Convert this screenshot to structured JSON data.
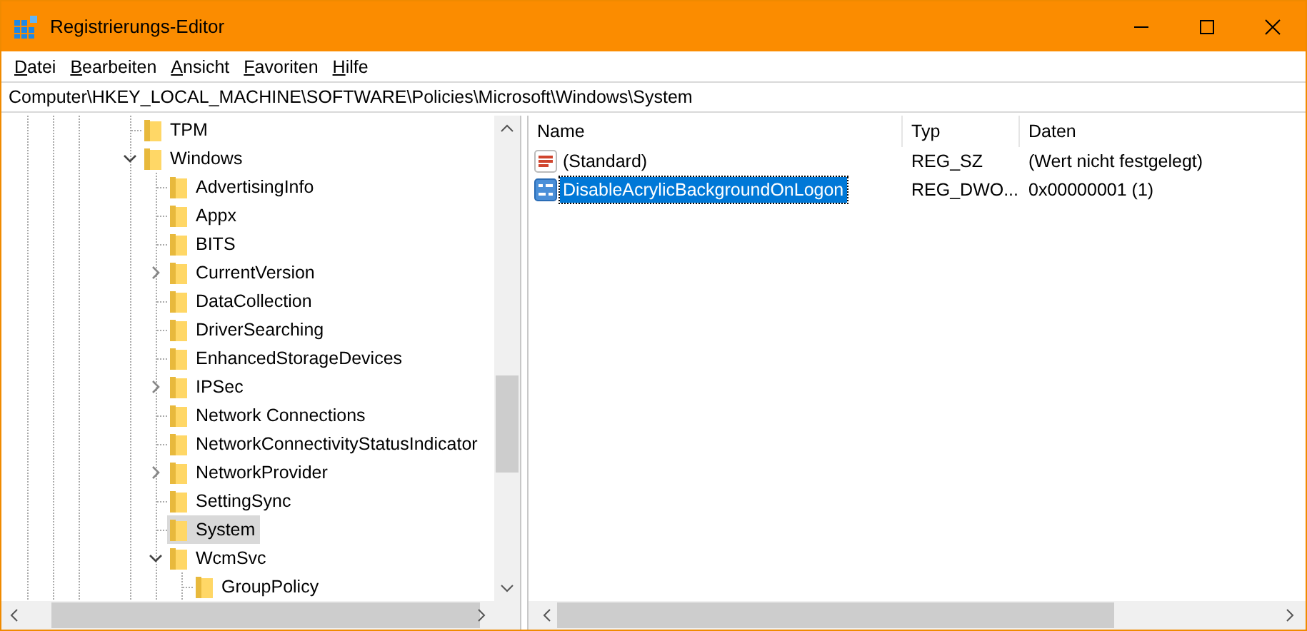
{
  "window": {
    "title": "Registrierungs-Editor"
  },
  "menu": [
    {
      "label": "Datei"
    },
    {
      "label": "Bearbeiten"
    },
    {
      "label": "Ansicht"
    },
    {
      "label": "Favoriten"
    },
    {
      "label": "Hilfe"
    }
  ],
  "address": "Computer\\HKEY_LOCAL_MACHINE\\SOFTWARE\\Policies\\Microsoft\\Windows\\System",
  "tree": [
    {
      "label": "TPM",
      "selected": false
    },
    {
      "label": "Windows",
      "selected": false,
      "expanded": true,
      "children": [
        {
          "label": "AdvertisingInfo",
          "selected": false
        },
        {
          "label": "Appx",
          "selected": false
        },
        {
          "label": "BITS",
          "selected": false
        },
        {
          "label": "CurrentVersion",
          "selected": false,
          "expanded": false
        },
        {
          "label": "DataCollection",
          "selected": false
        },
        {
          "label": "DriverSearching",
          "selected": false
        },
        {
          "label": "EnhancedStorageDevices",
          "selected": false
        },
        {
          "label": "IPSec",
          "selected": false,
          "expanded": false
        },
        {
          "label": "Network Connections",
          "selected": false
        },
        {
          "label": "NetworkConnectivityStatusIndicator",
          "selected": false
        },
        {
          "label": "NetworkProvider",
          "selected": false,
          "expanded": false
        },
        {
          "label": "SettingSync",
          "selected": false
        },
        {
          "label": "System",
          "selected": true
        },
        {
          "label": "WcmSvc",
          "selected": false,
          "expanded": true,
          "children": [
            {
              "label": "GroupPolicy",
              "selected": false
            }
          ]
        }
      ]
    }
  ],
  "values": {
    "columns": [
      "Name",
      "Typ",
      "Daten"
    ],
    "rows": [
      {
        "kind": "string",
        "name": "(Standard)",
        "type": "REG_SZ",
        "data": "(Wert nicht festgelegt)",
        "selected": false
      },
      {
        "kind": "dword",
        "name": "DisableAcrylicBackgroundOnLogon",
        "type": "REG_DWO...",
        "data": "0x00000001 (1)",
        "selected": true
      }
    ]
  }
}
